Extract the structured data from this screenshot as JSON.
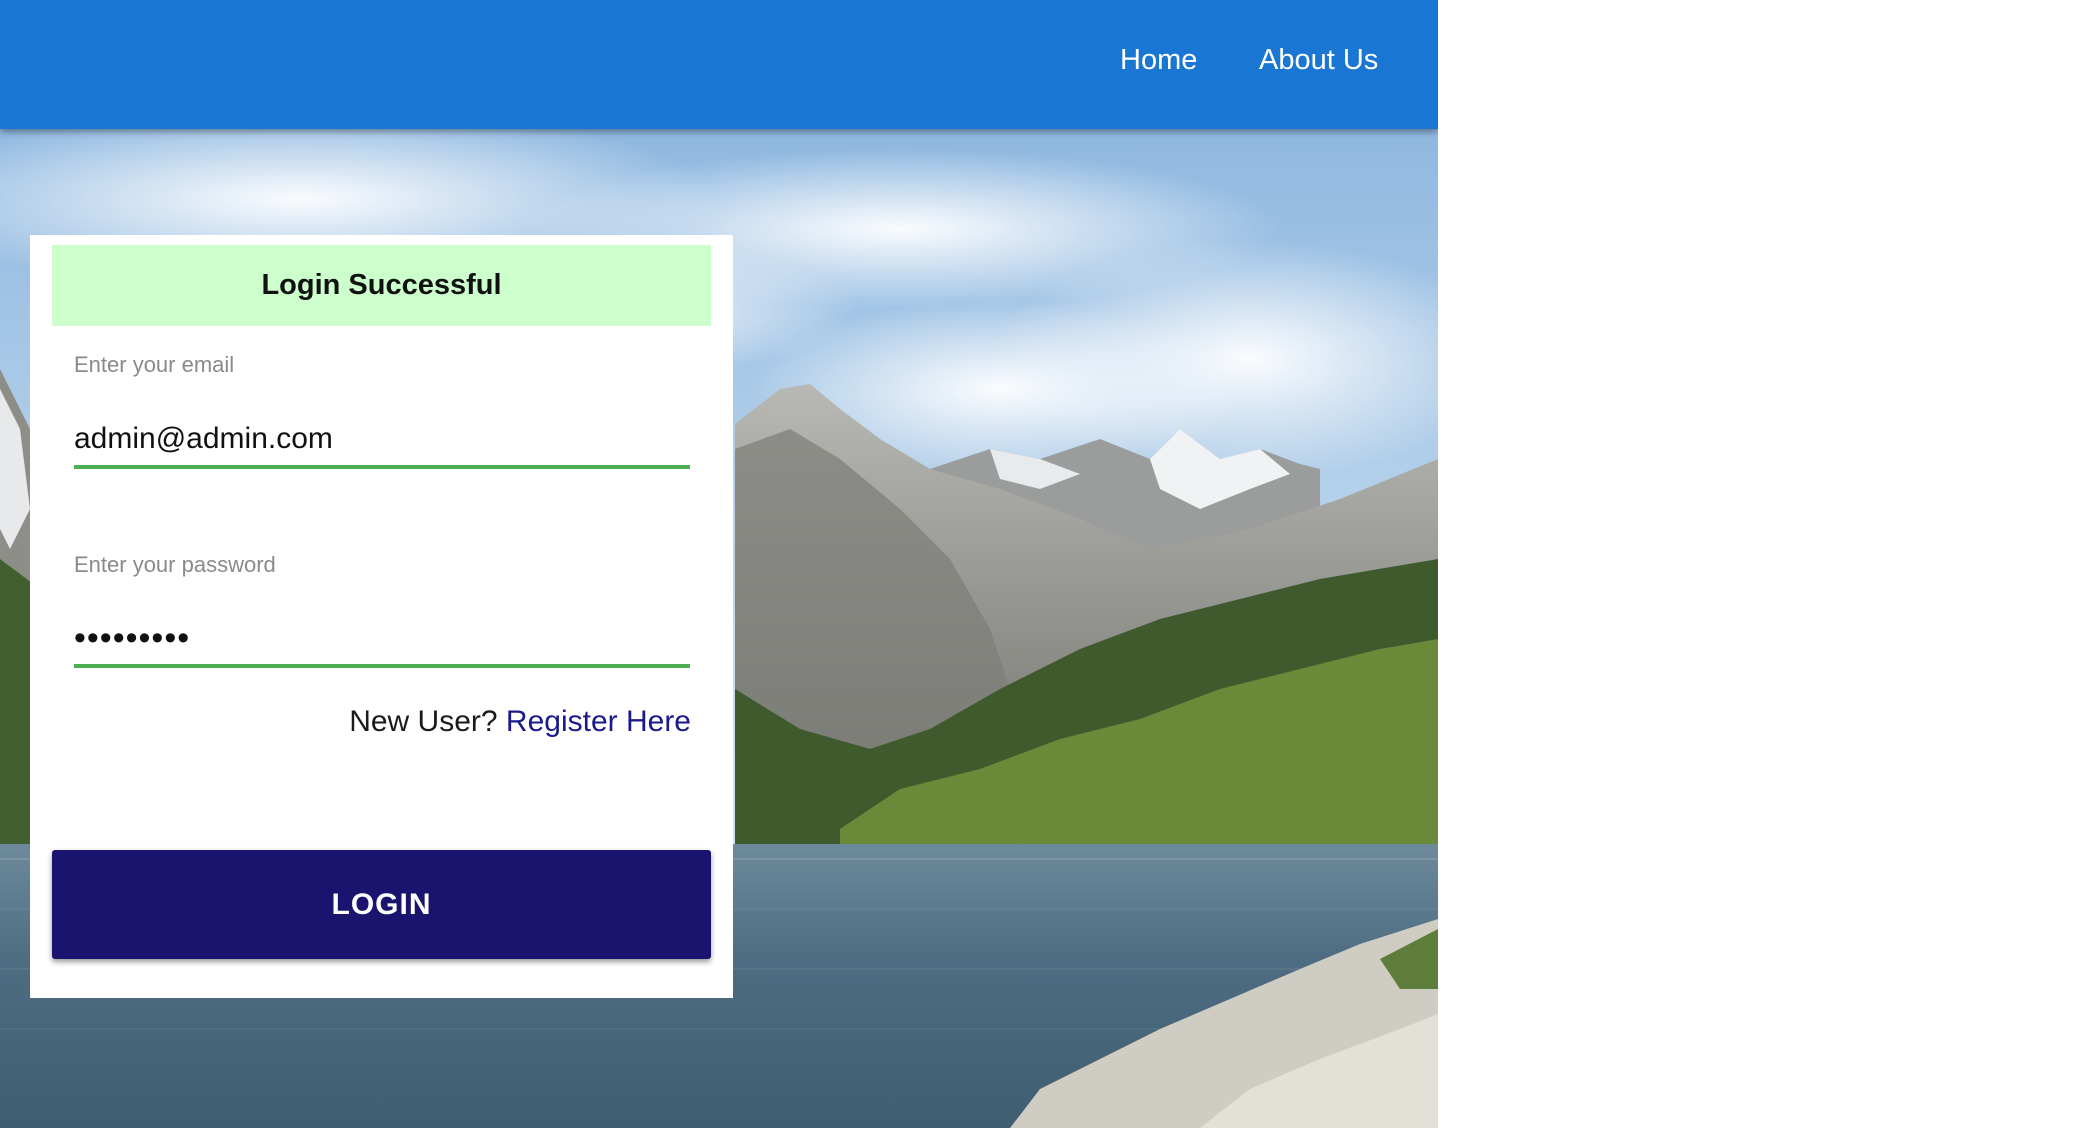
{
  "nav": {
    "home_label": "Home",
    "about_label": "About Us"
  },
  "background": {
    "image": "mountain-lake-landscape"
  },
  "login_card": {
    "status_message": "Login Successful",
    "email": {
      "label": "Enter your email",
      "value": "admin@admin.com"
    },
    "password": {
      "label": "Enter your password",
      "value": "•••••••••"
    },
    "register_prompt": "New User?",
    "register_link": "Register Here",
    "login_button": "LOGIN"
  },
  "colors": {
    "navbar": "#1976d2",
    "success_banner": "#ccffcc",
    "input_underline": "#4caf50",
    "login_button": "#1a146e",
    "register_link": "#1a1a8c"
  }
}
